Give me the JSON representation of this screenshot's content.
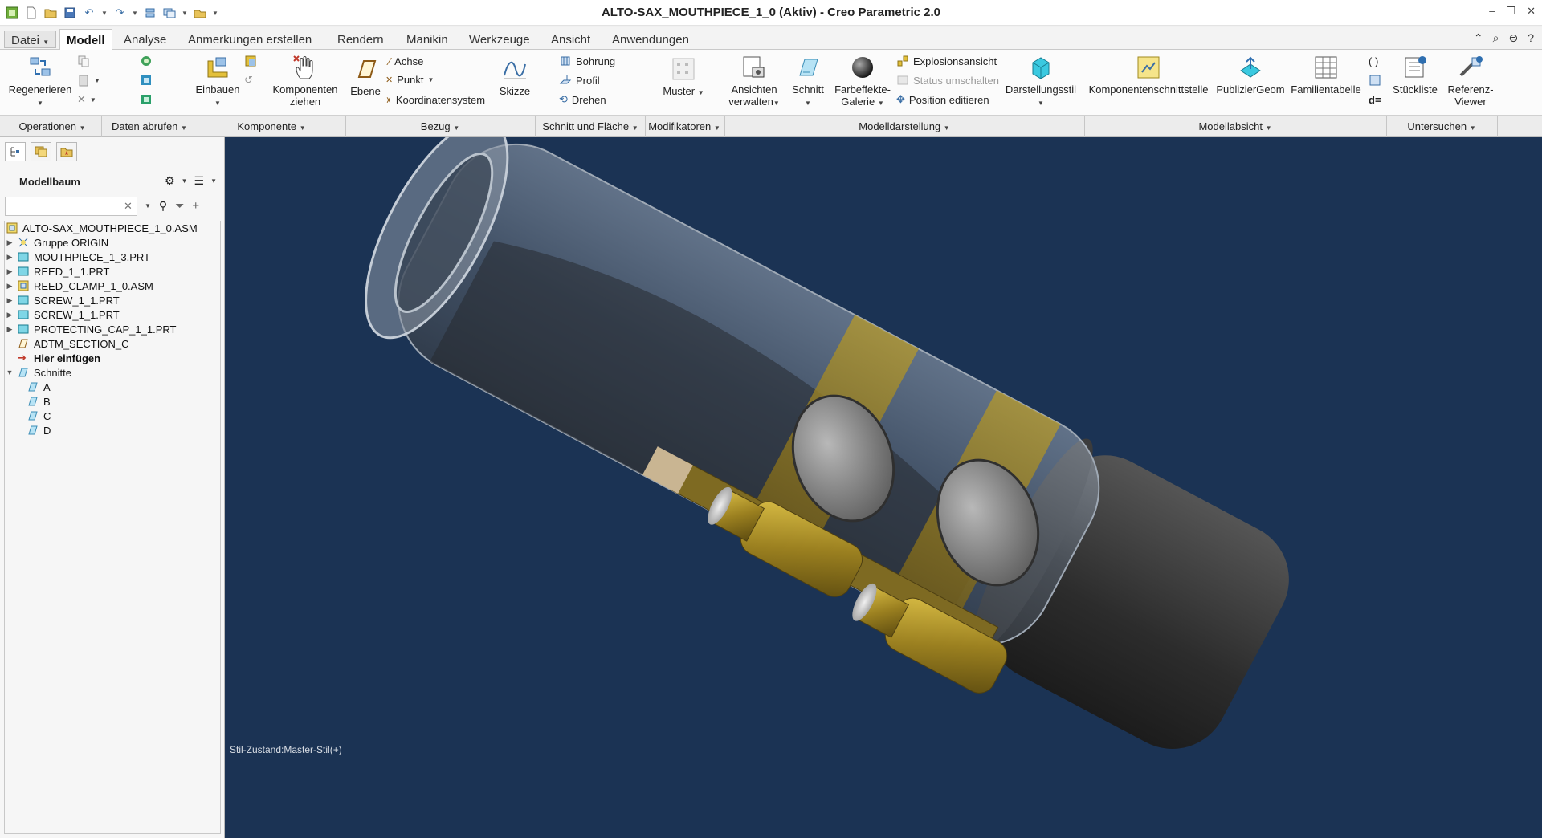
{
  "window": {
    "title": "ALTO-SAX_MOUTHPIECE_1_0 (Aktiv) - Creo Parametric 2.0"
  },
  "tabs": [
    {
      "label": "Datei"
    },
    {
      "label": "Modell"
    },
    {
      "label": "Analyse"
    },
    {
      "label": "Anmerkungen erstellen"
    },
    {
      "label": "Rendern"
    },
    {
      "label": "Manikin"
    },
    {
      "label": "Werkzeuge"
    },
    {
      "label": "Ansicht"
    },
    {
      "label": "Anwendungen"
    }
  ],
  "ribbon": {
    "regenerieren": "Regenerieren",
    "einbauen": "Einbauen",
    "komponenten_ziehen_1": "Komponenten",
    "komponenten_ziehen_2": "ziehen",
    "ebene": "Ebene",
    "achse": "Achse",
    "punkt": "Punkt",
    "koordinatensystem": "Koordinatensystem",
    "skizze": "Skizze",
    "bohrung": "Bohrung",
    "profil": "Profil",
    "drehen": "Drehen",
    "muster": "Muster",
    "ansichten_1": "Ansichten",
    "ansichten_2": "verwalten",
    "schnitt": "Schnitt",
    "farbeffekte_1": "Farbeffekte-",
    "farbeffekte_2": "Galerie",
    "explosionsansicht": "Explosionsansicht",
    "status_umschalten": "Status umschalten",
    "position_editieren": "Position editieren",
    "darstellungsstil": "Darstellungsstil",
    "komponentenschnittstelle": "Komponentenschnittstelle",
    "publiziergeom": "PublizierGeom",
    "familientabelle": "Familientabelle",
    "d_equals": "d=",
    "stueckliste": "Stückliste",
    "referenz_1": "Referenz-",
    "referenz_2": "Viewer"
  },
  "groups": {
    "operationen": "Operationen",
    "daten_abrufen": "Daten abrufen",
    "komponente": "Komponente",
    "bezug": "Bezug",
    "schnitt_flaeche": "Schnitt und Fläche",
    "modifikatoren": "Modifikatoren",
    "modelldarstellung": "Modelldarstellung",
    "modellabsicht": "Modellabsicht",
    "untersuchen": "Untersuchen"
  },
  "model_tree": {
    "title": "Modellbaum",
    "search_value": "",
    "items": [
      {
        "label": "ALTO-SAX_MOUTHPIECE_1_0.ASM"
      },
      {
        "label": "Gruppe ORIGIN"
      },
      {
        "label": "MOUTHPIECE_1_3.PRT"
      },
      {
        "label": "REED_1_1.PRT"
      },
      {
        "label": "REED_CLAMP_1_0.ASM"
      },
      {
        "label": "SCREW_1_1.PRT"
      },
      {
        "label": "SCREW_1_1.PRT"
      },
      {
        "label": "PROTECTING_CAP_1_1.PRT"
      },
      {
        "label": "ADTM_SECTION_C"
      },
      {
        "label": "Hier einfügen"
      },
      {
        "label": "Schnitte"
      },
      {
        "label": "A"
      },
      {
        "label": "B"
      },
      {
        "label": "C"
      },
      {
        "label": "D"
      }
    ]
  },
  "viewport": {
    "style_state": "Stil-Zustand:Master-Stil(+)"
  },
  "colors": {
    "viewport_bg": "#1b3354",
    "brass": "#b79a2a",
    "accent": "#3a6ea5"
  }
}
